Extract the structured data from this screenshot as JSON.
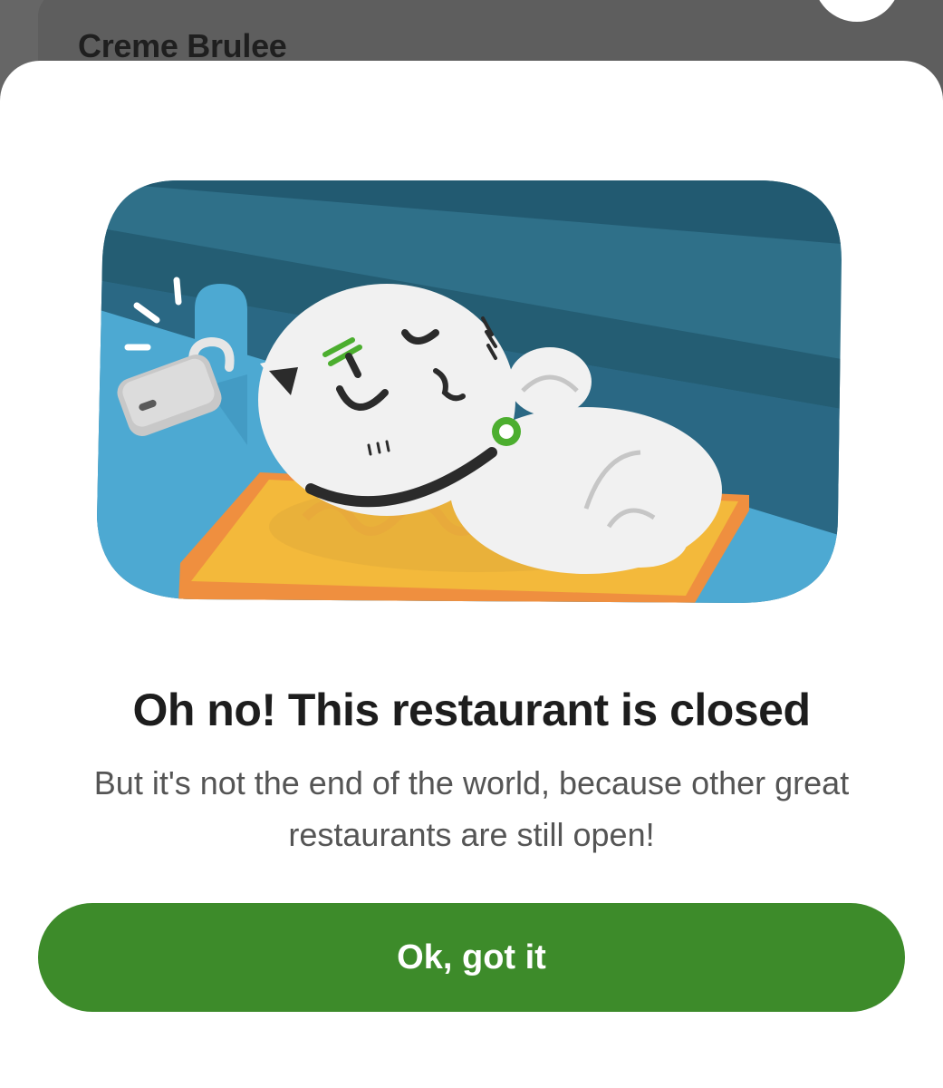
{
  "background_page": {
    "title": "Creme Brulee"
  },
  "modal": {
    "illustration_icon": "sleeping-cat-closed-restaurant-illustration",
    "title": "Oh no! This restaurant is closed",
    "message": "But it's not the end of the world, because other great restaurants are still open!",
    "primary_button_label": "Ok, got it"
  },
  "colors": {
    "accent": "#3d8b2a",
    "backdrop": "#666666",
    "title_text": "#1d1d1d",
    "body_text": "#555555"
  }
}
